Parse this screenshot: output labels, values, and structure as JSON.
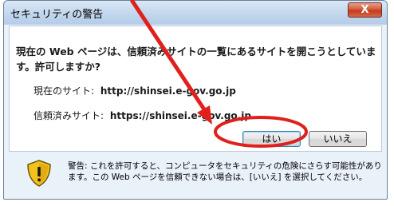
{
  "dialog": {
    "title": "セキュリティの警告",
    "close_label": "X",
    "message": "現在の Web ページは、信頼済みサイトの一覧にあるサイトを開こうとしています。許可しますか?",
    "current_site": {
      "label": "現在のサイト:",
      "value": "http://shinsei.e-gov.go.jp"
    },
    "trusted_site": {
      "label": "信頼済みサイト:",
      "value": "https://shinsei.e-gov.go.jp"
    },
    "yes_label": "はい",
    "no_label": "いいえ",
    "warning_text": "警告: これを許可すると、コンピュータをセキュリティの危険にさらす可能性があります。この Web ページを信頼できない場合は、[いいえ] を選択してください。",
    "shield_icon": "shield-warning-icon"
  },
  "annotation": {
    "arrow_color": "#e0201c",
    "highlight_color": "#e0201c"
  }
}
